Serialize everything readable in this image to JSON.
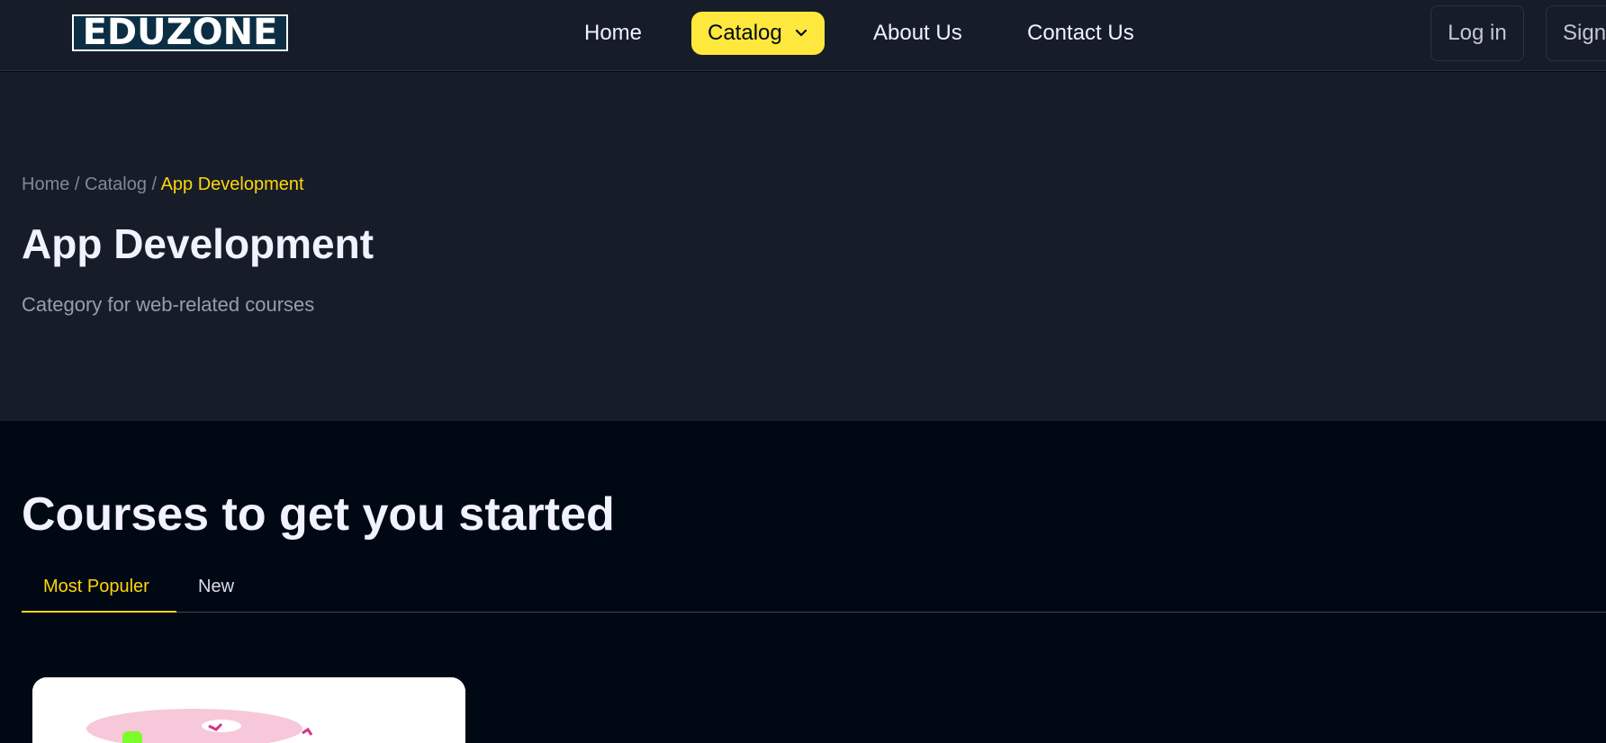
{
  "navbar": {
    "logo_text": "EDUZONE",
    "links": {
      "home": "Home",
      "catalog": "Catalog",
      "about": "About Us",
      "contact": "Contact Us"
    },
    "login_label": "Log in",
    "signup_label": "Sign up",
    "colors": {
      "accent": "#ffe83d",
      "background": "#161d29"
    }
  },
  "hero": {
    "breadcrumb": {
      "home": "Home",
      "catalog": "Catalog",
      "current": "App Development",
      "separator": "/"
    },
    "title": "App Development",
    "description": "Category for web-related courses"
  },
  "courses": {
    "section_title": "Courses to get you started",
    "tabs": [
      {
        "label": "Most Populer",
        "active": true
      },
      {
        "label": "New",
        "active": false
      }
    ]
  }
}
